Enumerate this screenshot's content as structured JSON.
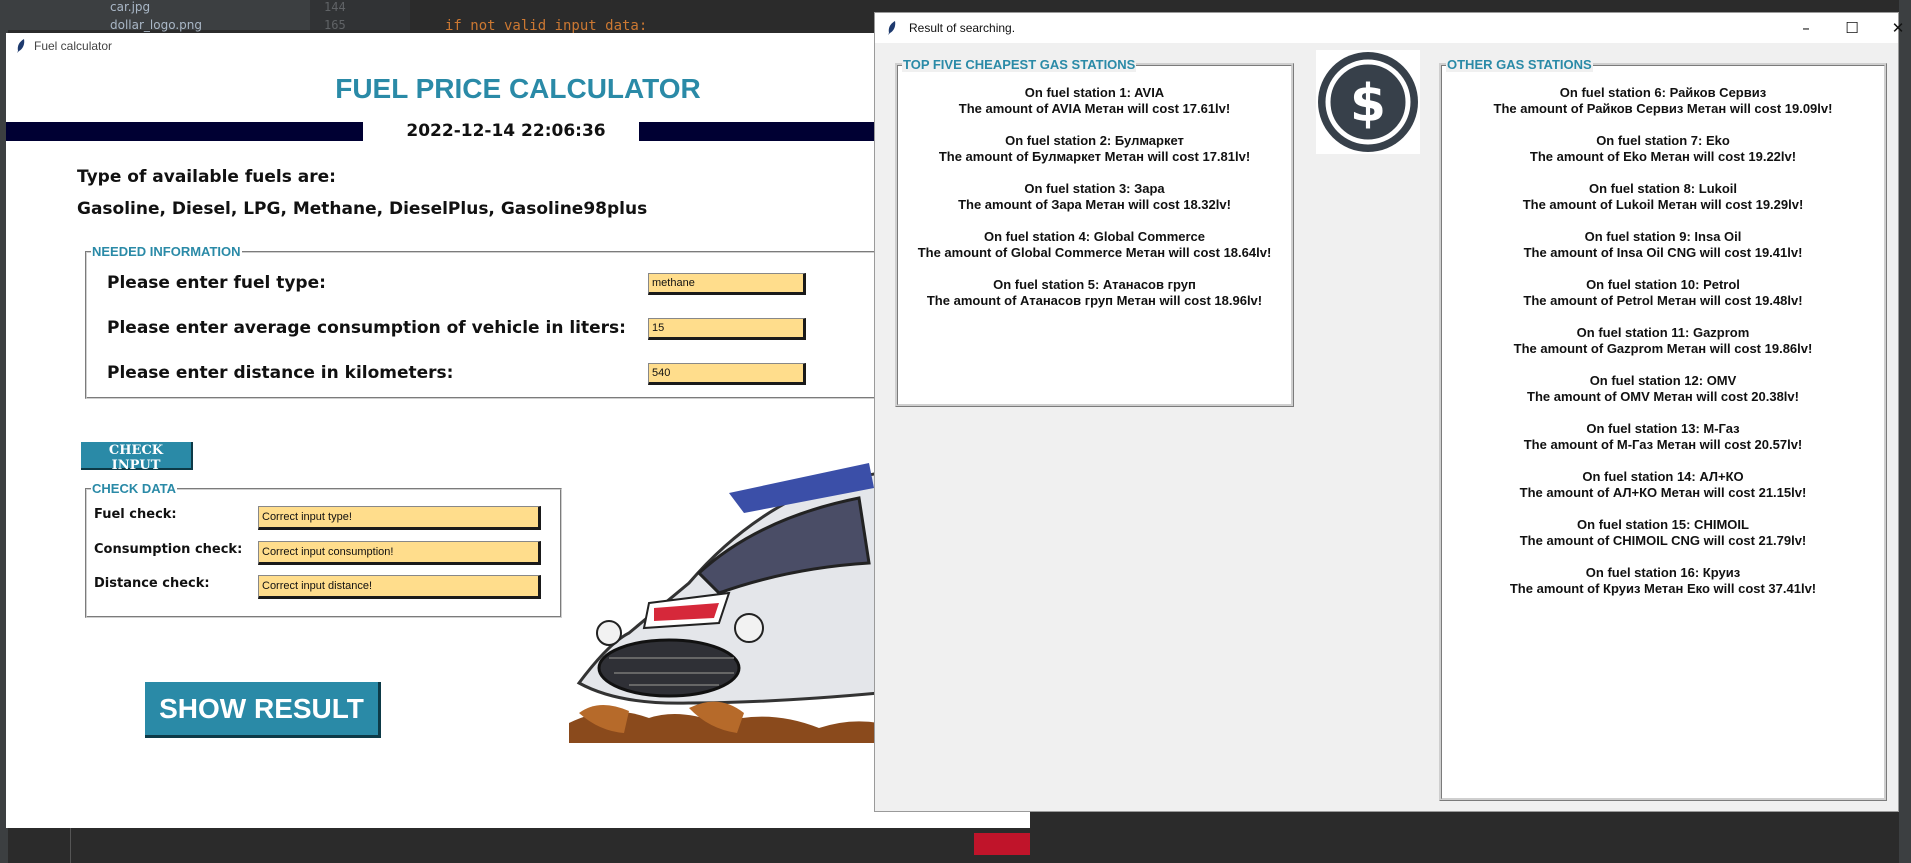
{
  "ide": {
    "files": [
      "car.jpg",
      "dollar_logo.png"
    ],
    "line_numbers": [
      "144",
      "165"
    ],
    "code_line": "if not valid_input_data:"
  },
  "calc_window": {
    "title": "Fuel calculator",
    "heading": "FUEL PRICE CALCULATOR",
    "datetime": "2022-12-14 22:06:36",
    "fuels_heading": "Type of available fuels are:",
    "fuels_list": "Gasoline, Diesel, LPG, Methane, DieselPlus, Gasoline98plus",
    "needed_info": {
      "legend": "NEEDED INFORMATION",
      "fuel_type_label": "Please enter fuel type:",
      "fuel_type_value": "methane",
      "consumption_label": "Please enter average consumption of vehicle in liters:",
      "consumption_value": "15",
      "distance_label": "Please enter distance in kilometers:",
      "distance_value": "540"
    },
    "check_input_button": "CHECK INPUT",
    "check_data": {
      "legend": "CHECK DATA",
      "fuel_check_label": "Fuel check:",
      "fuel_check_value": "Correct input type!",
      "consumption_check_label": "Consumption check:",
      "consumption_check_value": "Correct input consumption!",
      "distance_check_label": "Distance check:",
      "distance_check_value": "Correct input distance!"
    },
    "show_result_button": "SHOW RESULT"
  },
  "result_window": {
    "title": "Result of searching.",
    "controls": {
      "minimize": "–",
      "maximize": "☐",
      "close": "✕"
    },
    "top_five": {
      "legend": "TOP FIVE CHEAPEST GAS STATIONS",
      "stations": [
        {
          "line1": "On fuel station 1: AVIA",
          "line2": "The amount of AVIA Метан will cost 17.61lv!"
        },
        {
          "line1": "On fuel station 2: Булмаркет",
          "line2": "The amount of Булмаркет Метан will cost 17.81lv!"
        },
        {
          "line1": "On fuel station 3: Зара",
          "line2": "The amount of Зара Метан will cost 18.32lv!"
        },
        {
          "line1": "On fuel station 4: Global Commerce",
          "line2": "The amount of Global Commerce Метан will cost 18.64lv!"
        },
        {
          "line1": "On fuel station 5: Атанасов груп",
          "line2": "The amount of Атанасов груп Метан will cost 18.96lv!"
        }
      ]
    },
    "others": {
      "legend": "OTHER GAS STATIONS",
      "stations": [
        {
          "line1": "On fuel station 6: Райков Сервиз",
          "line2": "The amount of Райков Сервиз Метан will cost 19.09lv!"
        },
        {
          "line1": "On fuel station 7: Eko",
          "line2": "The amount of Eko Метан will cost 19.22lv!"
        },
        {
          "line1": "On fuel station 8: Lukoil",
          "line2": "The amount of Lukoil Метан will cost 19.29lv!"
        },
        {
          "line1": "On fuel station 9: Insa Oil",
          "line2": "The amount of Insa Oil CNG will cost 19.41lv!"
        },
        {
          "line1": "On fuel station 10: Petrol",
          "line2": "The amount of Petrol Метан will cost 19.48lv!"
        },
        {
          "line1": "On fuel station 11: Gazprom",
          "line2": "The amount of Gazprom Метан will cost 19.86lv!"
        },
        {
          "line1": "On fuel station 12: OMV",
          "line2": "The amount of OMV Метан will cost 20.38lv!"
        },
        {
          "line1": "On fuel station 13: М-Газ",
          "line2": "The amount of М-Газ Метан will cost 20.57lv!"
        },
        {
          "line1": "On fuel station 14: АЛ+КО",
          "line2": "The amount of АЛ+КО Метан will cost 21.15lv!"
        },
        {
          "line1": "On fuel station 15: CHIMOIL",
          "line2": "The amount of CHIMOIL CNG will cost 21.79lv!"
        },
        {
          "line1": "On fuel station 16: Круиз",
          "line2": "The amount of Круиз Метан Еко will cost 37.41lv!"
        }
      ]
    }
  },
  "colors": {
    "accent": "#2a8aa7",
    "entry_bg": "#ffdd8c",
    "banner": "#000033",
    "ide_bg": "#2b2b2b"
  }
}
